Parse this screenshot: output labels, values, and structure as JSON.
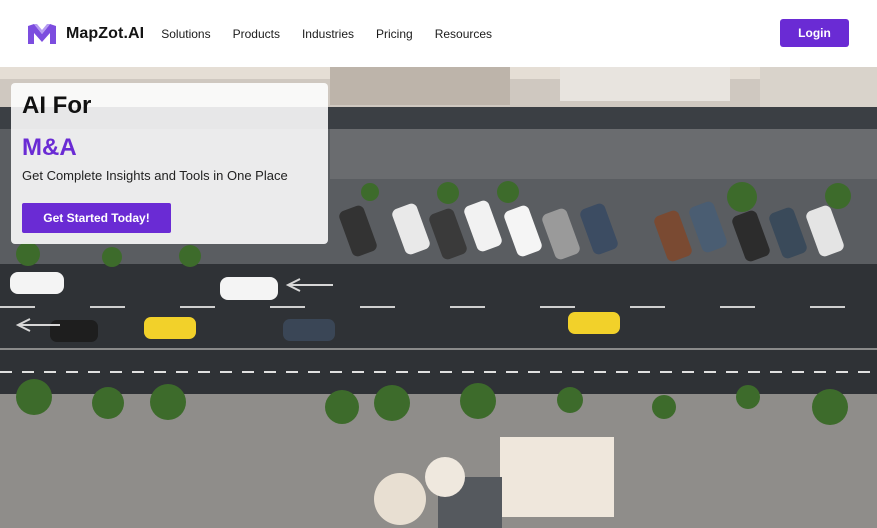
{
  "brand": {
    "name": "MapZot.AI",
    "logo_icon": "mapzot-logo-icon",
    "color": "#6a2bd4"
  },
  "nav": {
    "items": [
      {
        "label": "Solutions"
      },
      {
        "label": "Products"
      },
      {
        "label": "Industries"
      },
      {
        "label": "Pricing"
      },
      {
        "label": "Resources"
      }
    ],
    "login_label": "Login"
  },
  "hero": {
    "title_line1": "AI For",
    "title_line2": "M&A",
    "subtitle": "Get Complete Insights and Tools in One Place",
    "cta_label": "Get Started Today!",
    "background": "aerial-street-photo"
  }
}
